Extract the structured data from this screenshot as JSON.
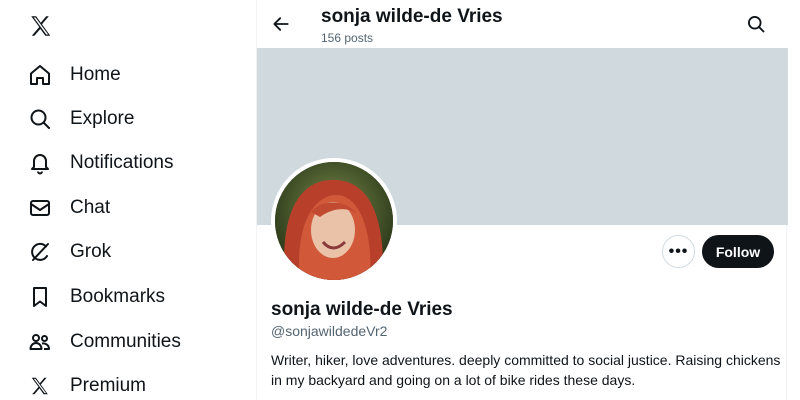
{
  "nav": {
    "logo_icon": "x-logo-icon",
    "items": [
      {
        "label": "Home",
        "icon": "home-icon"
      },
      {
        "label": "Explore",
        "icon": "search-icon"
      },
      {
        "label": "Notifications",
        "icon": "bell-icon"
      },
      {
        "label": "Chat",
        "icon": "mail-icon"
      },
      {
        "label": "Grok",
        "icon": "grok-icon"
      },
      {
        "label": "Bookmarks",
        "icon": "bookmark-icon"
      },
      {
        "label": "Communities",
        "icon": "communities-icon"
      },
      {
        "label": "Premium",
        "icon": "x-logo-icon"
      }
    ]
  },
  "header": {
    "name": "sonja wilde-de Vries",
    "posts": "156 posts"
  },
  "profile": {
    "display_name": "sonja wilde-de Vries",
    "handle": "@sonjawildedeVr2",
    "bio": "Writer, hiker, love adventures. deeply committed to social justice.  Raising chickens in my backyard and going on a lot of bike rides these days.",
    "more_label": "•••",
    "follow_label": "Follow"
  },
  "colors": {
    "banner": "#cfd9de",
    "follow_bg": "#0f1419",
    "secondary_text": "#536471"
  }
}
